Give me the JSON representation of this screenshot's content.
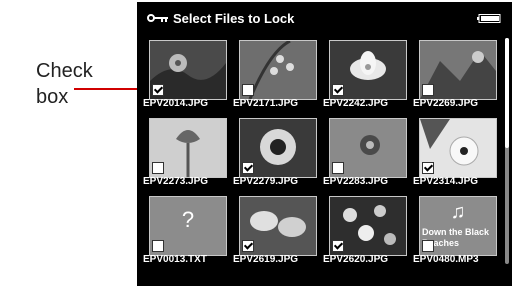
{
  "callout": {
    "line1": "Check",
    "line2": "box"
  },
  "header": {
    "title": "Select Files to Lock",
    "icons": [
      "key-icon",
      "battery-icon"
    ]
  },
  "files": [
    {
      "name": "EPV2014.JPG",
      "checked": true
    },
    {
      "name": "EPV2171.JPG",
      "checked": false
    },
    {
      "name": "EPV2242.JPG",
      "checked": true
    },
    {
      "name": "EPV2269.JPG",
      "checked": false
    },
    {
      "name": "EPV2273.JPG",
      "checked": false
    },
    {
      "name": "EPV2279.JPG",
      "checked": true
    },
    {
      "name": "EPV2283.JPG",
      "checked": false
    },
    {
      "name": "EPV2314.JPG",
      "checked": true
    },
    {
      "name": "EPV0013.TXT",
      "checked": false,
      "placeholder_glyph": "?"
    },
    {
      "name": "EPV2619.JPG",
      "checked": true
    },
    {
      "name": "EPV2620.JPG",
      "checked": true
    },
    {
      "name": "EPV0480.MP3",
      "checked": false,
      "placeholder_glyph": "♫",
      "song_title": "Down the Black Beaches"
    }
  ],
  "colors": {
    "screen_bg": "#000000",
    "accent_line": "#d00000",
    "tile_border": "#c8c8c8"
  }
}
